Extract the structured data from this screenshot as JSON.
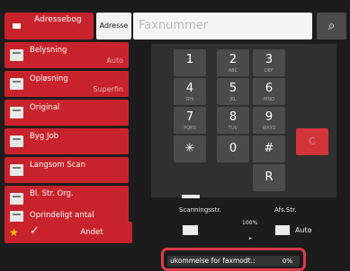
{
  "left_panel": {
    "address_book_label": "Adressebog",
    "items": [
      {
        "label": "Belysning",
        "value": "Auto"
      },
      {
        "label": "Opløsning",
        "value": "Superfin"
      },
      {
        "label": "Original",
        "value": ""
      },
      {
        "label": "Byg Job",
        "value": ""
      },
      {
        "label": "Langsom Scan",
        "value": ""
      },
      {
        "label": "Bl. Str. Org.",
        "value": ""
      },
      {
        "label": "Oprindeligt antal",
        "value": ""
      }
    ],
    "bottom": {
      "star_icon": "star-icon",
      "check_icon": "check-icon",
      "other_label": "Andet"
    }
  },
  "address_field": {
    "address_button_label": "Adresse",
    "fax_placeholder": "Faxnummer",
    "search_icon": "search-icon"
  },
  "keypad": {
    "keys": [
      {
        "main": "1",
        "sub": ""
      },
      {
        "main": "2",
        "sub": "ABC"
      },
      {
        "main": "3",
        "sub": "DEF"
      },
      {
        "main": "4",
        "sub": "GHI"
      },
      {
        "main": "5",
        "sub": "JKL"
      },
      {
        "main": "6",
        "sub": "MNO"
      },
      {
        "main": "7",
        "sub": "PQRS"
      },
      {
        "main": "8",
        "sub": "TUV"
      },
      {
        "main": "9",
        "sub": "WXYZ"
      },
      {
        "main": "✳",
        "sub": ""
      },
      {
        "main": "0",
        "sub": ""
      },
      {
        "main": "#",
        "sub": ""
      },
      {
        "main": "R",
        "sub": ""
      }
    ],
    "clear_label": "C"
  },
  "scan_settings": {
    "scan_size_label": "Scanningsstr.",
    "send_size_label": "Afs.Str.",
    "ratio": "100%",
    "send_size_value": "Auto"
  },
  "status": {
    "label": "ukommelse for faxmodt.:",
    "value": "0%"
  },
  "colors": {
    "accent": "#c8232c",
    "background": "#1c1c1c",
    "key": "#4b4b4b",
    "highlight_border": "#e03a46"
  }
}
